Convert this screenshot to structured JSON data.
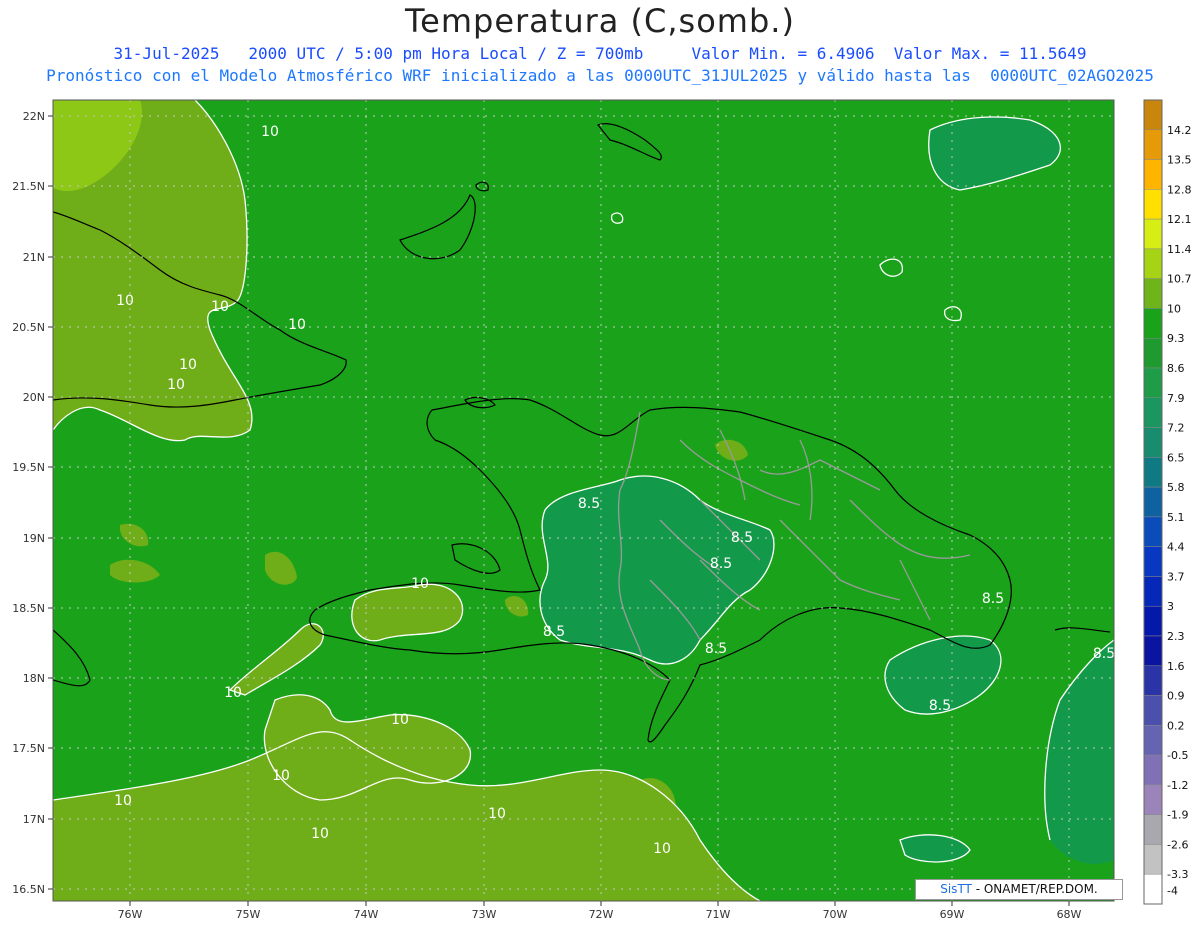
{
  "header": {
    "title": "Temperatura (C,somb.)",
    "subtitle1": "31-Jul-2025   2000 UTC / 5:00 pm Hora Local / Z = 700mb     Valor Min. = 6.4906  Valor Max. = 11.5649",
    "subtitle2": "Pronóstico con el Modelo Atmosférico WRF inicializado a las 0000UTC_31JUL2025 y válido hasta las  0000UTC_02AGO2025"
  },
  "map": {
    "lat_labels": [
      "22N",
      "21.5N",
      "21N",
      "20.5N",
      "20N",
      "19.5N",
      "19N",
      "18.5N",
      "18N",
      "17.5N",
      "17N",
      "16.5N"
    ],
    "lon_labels": [
      "76W",
      "75W",
      "74W",
      "73W",
      "72W",
      "71W",
      "70W",
      "69W",
      "68W"
    ],
    "contour_labels": [
      {
        "text": "10"
      },
      {
        "text": "10"
      },
      {
        "text": "10"
      },
      {
        "text": "10"
      },
      {
        "text": "10"
      },
      {
        "text": "10"
      },
      {
        "text": "10"
      },
      {
        "text": "10"
      },
      {
        "text": "10"
      },
      {
        "text": "10"
      },
      {
        "text": "10"
      },
      {
        "text": "10"
      },
      {
        "text": "10"
      },
      {
        "text": "10"
      },
      {
        "text": "8.5"
      },
      {
        "text": "8.5"
      },
      {
        "text": "8.5"
      },
      {
        "text": "8.5"
      },
      {
        "text": "8.5"
      },
      {
        "text": "8.5"
      },
      {
        "text": "8.5"
      },
      {
        "text": "8.5"
      }
    ],
    "colors": {
      "base": "#1aa31a",
      "warm": "#70ae12",
      "cool": "#129a4a",
      "coast": "#000000",
      "provinces": "#9a9a9a",
      "contour": "#ffffff"
    }
  },
  "colorbar": {
    "levels": [
      {
        "label": "14.2",
        "color": "#c8860c"
      },
      {
        "label": "13.5",
        "color": "#e69a08"
      },
      {
        "label": "12.8",
        "color": "#ffb400"
      },
      {
        "label": "12.1",
        "color": "#ffe000"
      },
      {
        "label": "11.4",
        "color": "#d6ee14"
      },
      {
        "label": "10.7",
        "color": "#a6d414"
      },
      {
        "label": "10",
        "color": "#6fb41a"
      },
      {
        "label": "9.3",
        "color": "#1aa31a"
      },
      {
        "label": "8.6",
        "color": "#1f9a2e"
      },
      {
        "label": "7.9",
        "color": "#1e9c48"
      },
      {
        "label": "7.2",
        "color": "#1c9660"
      },
      {
        "label": "6.5",
        "color": "#178c6e"
      },
      {
        "label": "5.8",
        "color": "#107a84"
      },
      {
        "label": "5.1",
        "color": "#0e62a0"
      },
      {
        "label": "4.4",
        "color": "#0a4cba"
      },
      {
        "label": "3.7",
        "color": "#0838c2"
      },
      {
        "label": "3",
        "color": "#0628b8"
      },
      {
        "label": "2.3",
        "color": "#0419aa"
      },
      {
        "label": "1.6",
        "color": "#0a14a0"
      },
      {
        "label": "0.9",
        "color": "#2a34a6"
      },
      {
        "label": "0.2",
        "color": "#4a50ac"
      },
      {
        "label": "-0.5",
        "color": "#6464b2"
      },
      {
        "label": "-1.2",
        "color": "#8070b6"
      },
      {
        "label": "-1.9",
        "color": "#9a84ba"
      },
      {
        "label": "-2.6",
        "color": "#a8a8ae"
      },
      {
        "label": "-3.3",
        "color": "#c2c2c2"
      },
      {
        "label": "-4",
        "color": "#ffffff"
      }
    ]
  },
  "credit": {
    "brand": "SisTT",
    "text": " - ONAMET/REP.DOM."
  }
}
